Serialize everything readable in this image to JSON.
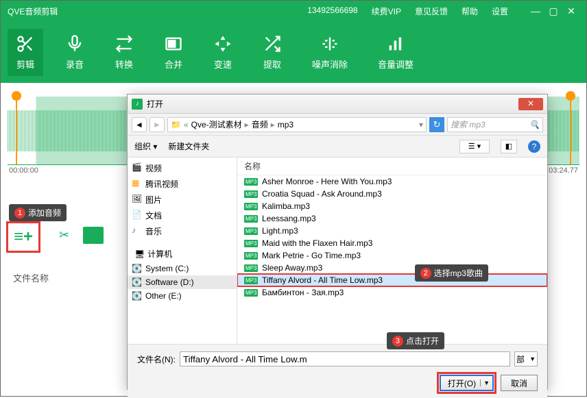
{
  "app_title": "QVE音频剪辑",
  "top_menu": {
    "phone": "13492566698",
    "vip": "续费VIP",
    "feedback": "意见反馈",
    "help": "帮助",
    "settings": "设置"
  },
  "toolbar": [
    {
      "label": "剪辑"
    },
    {
      "label": "录音"
    },
    {
      "label": "转换"
    },
    {
      "label": "合并"
    },
    {
      "label": "变速"
    },
    {
      "label": "提取"
    },
    {
      "label": "噪声消除"
    },
    {
      "label": "音量调整"
    }
  ],
  "time": {
    "start": "00:00:00",
    "end": "03:24.77"
  },
  "annot1": "添加音频",
  "filelabel": "文件名称",
  "dialog": {
    "title": "打开",
    "crumbs": [
      "Qve-测试素材",
      "音频",
      "mp3"
    ],
    "search_placeholder": "搜索 mp3",
    "organize": "组织",
    "newfolder": "新建文件夹",
    "sidebar": [
      {
        "label": "视频",
        "icon": "video"
      },
      {
        "label": "腾讯视频",
        "icon": "tencent"
      },
      {
        "label": "图片",
        "icon": "image"
      },
      {
        "label": "文档",
        "icon": "doc"
      },
      {
        "label": "音乐",
        "icon": "music"
      }
    ],
    "computer": "计算机",
    "drives": [
      {
        "label": "System (C:)"
      },
      {
        "label": "Software (D:)"
      },
      {
        "label": "Other (E:)"
      }
    ],
    "col_name": "名称",
    "files": [
      "Asher Monroe - Here With You.mp3",
      "Croatia Squad - Ask Around.mp3",
      "Kalimba.mp3",
      "Leessang.mp3",
      "Light.mp3",
      "Maid with the Flaxen Hair.mp3",
      "Mark Petrie - Go Time.mp3",
      "Sleep Away.mp3",
      "Tiffany Alvord - All Time Low.mp3",
      "Бамбинтон - Зая.mp3"
    ],
    "selected_index": 8,
    "annot2": "选择mp3歌曲",
    "filename_label": "文件名(N):",
    "filename_value": "Tiffany Alvord - All Time Low.m",
    "filetype": "部",
    "annot3": "点击打开",
    "open": "打开(O)",
    "cancel": "取消"
  }
}
